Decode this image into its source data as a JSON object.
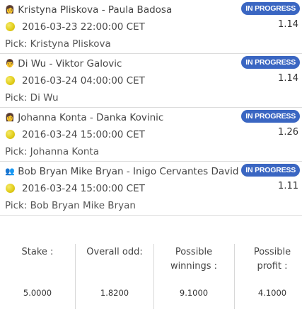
{
  "bets": [
    {
      "icon": "👩",
      "players": "Kristyna Pliskova -  Paula Badosa",
      "status": "IN PROGRESS",
      "datetime": "2016-03-23 22:00:00 CET",
      "odd": "1.14",
      "pick": "Pick: Kristyna Pliskova"
    },
    {
      "icon": "👨",
      "players": "Di Wu -  Viktor Galovic",
      "status": "IN PROGRESS",
      "datetime": "2016-03-24 04:00:00 CET",
      "odd": "1.14",
      "pick": "Pick: Di Wu"
    },
    {
      "icon": "👩",
      "players": "Johanna Konta -  Danka Kovinic",
      "status": "IN PROGRESS",
      "datetime": "2016-03-24 15:00:00 CET",
      "odd": "1.26",
      "pick": "Pick: Johanna Konta"
    },
    {
      "icon": "👥",
      "players": "Bob Bryan Mike Bryan -  Inigo Cervantes David Ferrer",
      "status": "IN PROGRESS",
      "datetime": "2016-03-24 15:00:00 CET",
      "odd": "1.11",
      "pick": "Pick: Bob Bryan Mike Bryan"
    }
  ],
  "summary": {
    "stake_label": "Stake :",
    "stake_value": "5.0000",
    "odd_label": "Overall odd:",
    "odd_value": "1.8200",
    "winnings_label": "Possible winnings :",
    "winnings_value": "9.1000",
    "profit_label": "Possible profit :",
    "profit_value": "4.1000"
  }
}
